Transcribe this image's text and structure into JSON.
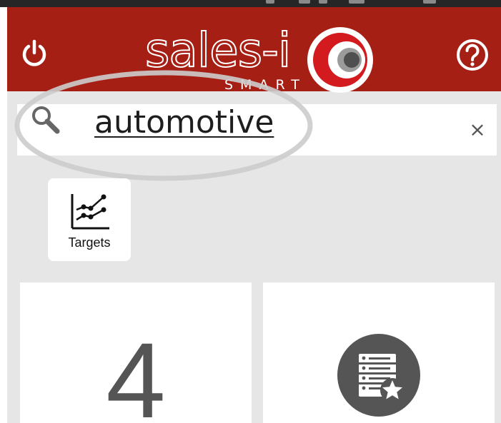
{
  "header": {
    "brand": "sales-i",
    "tagline": "SMART",
    "power_icon": "power-icon",
    "help_icon": "help-icon",
    "color": "#a51f14"
  },
  "search": {
    "query": "automotive",
    "clear_label": "×",
    "search_icon": "search-icon"
  },
  "shortcuts": [
    {
      "label": "Targets",
      "icon": "trend-chart-icon"
    }
  ],
  "cards": {
    "count": {
      "value": "4"
    },
    "favourites": {
      "icon": "starred-list-icon"
    }
  },
  "colors": {
    "accent": "#a51f14",
    "background": "#e6e6e6",
    "icon_gray": "#555555",
    "highlight": "#cccccc"
  }
}
